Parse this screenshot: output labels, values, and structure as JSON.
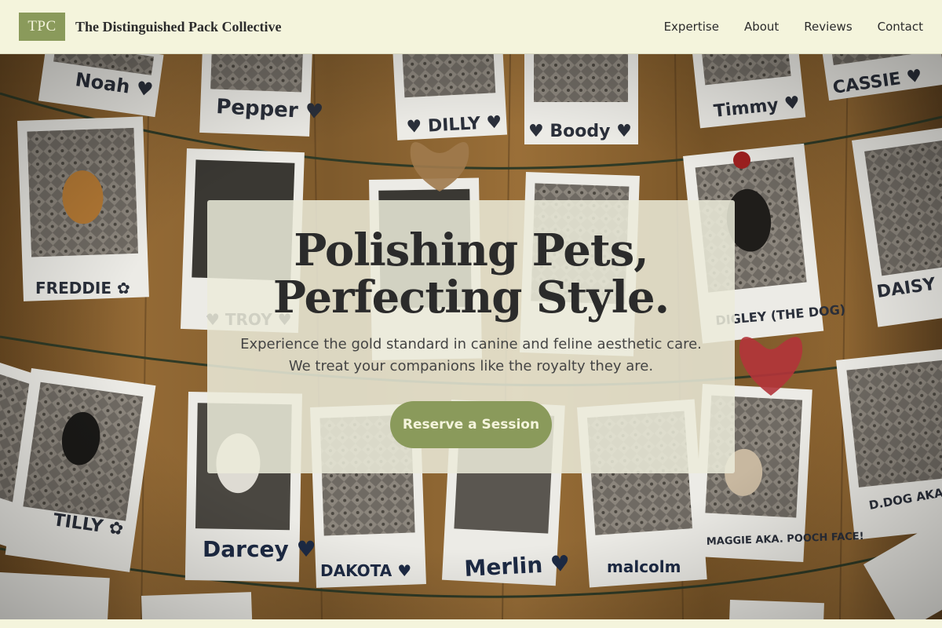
{
  "header": {
    "logo_text": "TPC",
    "brand_name": "The Distinguished Pack Collective",
    "nav": [
      {
        "label": "Expertise"
      },
      {
        "label": "About"
      },
      {
        "label": "Reviews"
      },
      {
        "label": "Contact"
      }
    ]
  },
  "hero": {
    "headline_line1": "Polishing Pets,",
    "headline_line2": "Perfecting Style.",
    "subtext": "Experience the gold standard in canine and feline aesthetic care. We treat your companions like the royalty they are.",
    "cta_label": "Reserve a Session",
    "photo_labels": [
      "Noah",
      "Pepper",
      "DILLY",
      "Boody",
      "Timmy",
      "CASSIE",
      "FREDDIE",
      "TROY",
      "DAISY",
      "DIGLEY (THE DOG)",
      "TILLY",
      "Darcey",
      "DAKOTA",
      "Merlin",
      "malcolm",
      "MAGGIE AKA. POOCH FACE!",
      "D.DOG AKA DI"
    ]
  },
  "colors": {
    "accent": "#8a9a5b",
    "background": "#f4f4dc",
    "text": "#2b2b2b",
    "wood": "#8a6232"
  }
}
